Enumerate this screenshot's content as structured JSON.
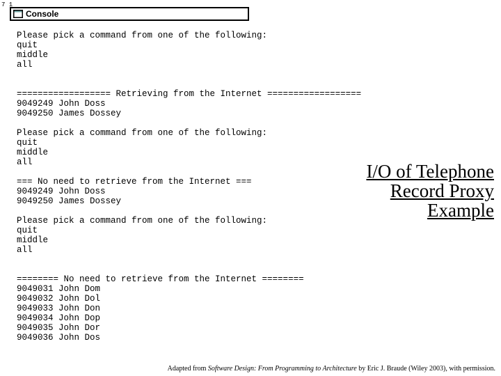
{
  "page_marker": "7\n1",
  "console": {
    "title": "Console"
  },
  "output": "Please pick a command from one of the following:\nquit\nmiddle\nall\n\n\n================== Retrieving from the Internet ==================\n9049249 John Doss\n9049250 James Dossey\n\nPlease pick a command from one of the following:\nquit\nmiddle\nall\n\n=== No need to retrieve from the Internet ===\n9049249 John Doss\n9049250 James Dossey\n\nPlease pick a command from one of the following:\nquit\nmiddle\nall\n\n\n======== No need to retrieve from the Internet ========\n9049031 John Dom\n9049032 John Dol\n9049033 John Don\n9049034 John Dop\n9049035 John Dor\n9049036 John Dos",
  "slide_title": "I/O of Telephone Record Proxy Example",
  "attribution": {
    "prefix": "Adapted from ",
    "book": "Software Design: From Programming to Architecture",
    "suffix": " by Eric J. Braude (Wiley 2003), with permission."
  }
}
